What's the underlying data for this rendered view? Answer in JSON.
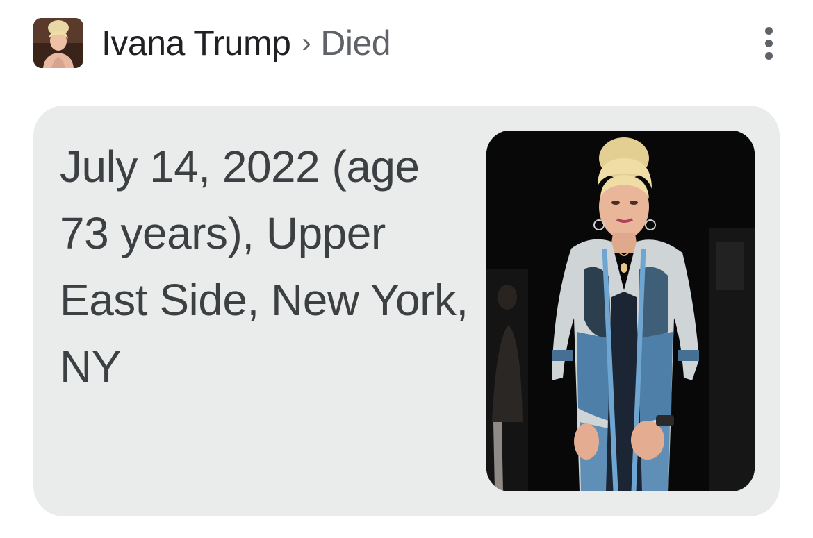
{
  "header": {
    "entity": "Ivana Trump",
    "separator": "›",
    "attribute": "Died",
    "thumbnail_icon": "person-portrait-thumbnail",
    "menu_icon": "more-vert-icon"
  },
  "card": {
    "answer": "July 14, 2022 (age 73 years), Upper East Side, New York, NY",
    "photo_icon": "person-portrait-photo"
  },
  "colors": {
    "card_background": "#eaebeb",
    "primary_text": "#202124",
    "secondary_text": "#5f6368",
    "answer_text": "#3c4043"
  }
}
